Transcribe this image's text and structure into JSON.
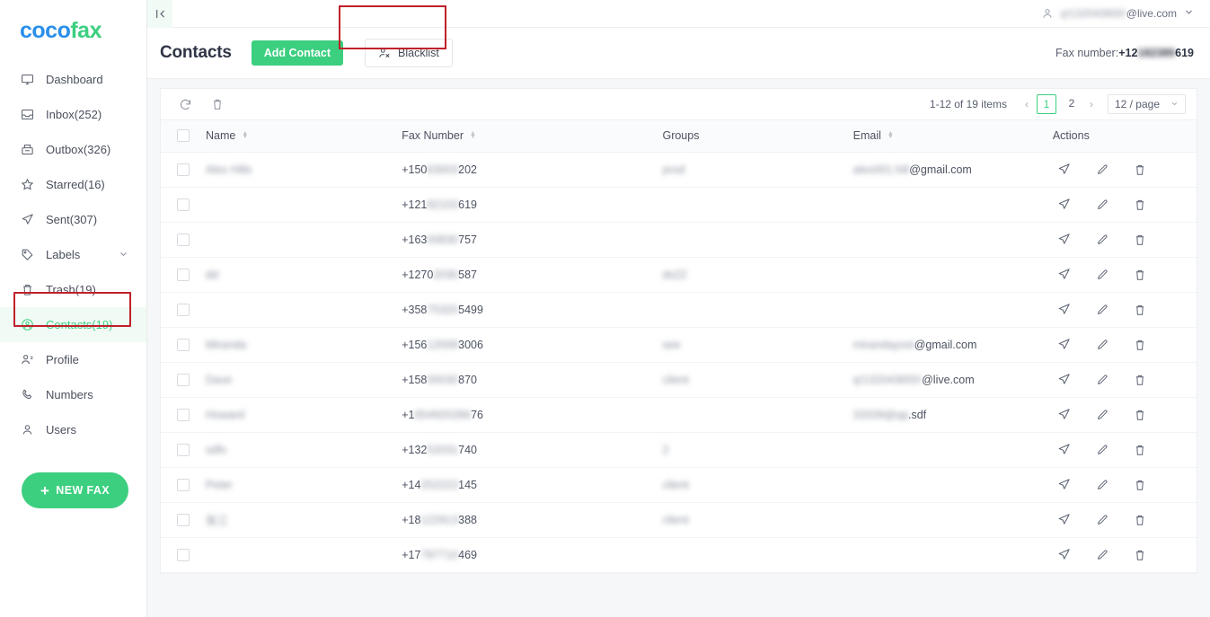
{
  "brand": {
    "name_part1": "coco",
    "name_part2": "fax"
  },
  "sidebar": {
    "items": [
      {
        "label": "Dashboard",
        "icon": "monitor-icon",
        "active": false
      },
      {
        "label": "Inbox(252)",
        "icon": "inbox-icon",
        "active": false
      },
      {
        "label": "Outbox(326)",
        "icon": "outbox-icon",
        "active": false
      },
      {
        "label": "Starred(16)",
        "icon": "star-icon",
        "active": false
      },
      {
        "label": "Sent(307)",
        "icon": "send-icon",
        "active": false
      },
      {
        "label": "Labels",
        "icon": "tag-icon",
        "active": false
      },
      {
        "label": "Trash(19)",
        "icon": "trash-icon",
        "active": false
      },
      {
        "label": "Contacts(19)",
        "icon": "contact-icon",
        "active": true
      },
      {
        "label": "Profile",
        "icon": "profile-icon",
        "active": false
      },
      {
        "label": "Numbers",
        "icon": "phone-icon",
        "active": false
      },
      {
        "label": "Users",
        "icon": "user-icon",
        "active": false
      }
    ],
    "new_fax_label": "NEW FAX",
    "new_fax_plus": "+"
  },
  "topbar": {
    "collapse_icon": "collapse-left-icon",
    "account_email_blurred": "q!132043655!",
    "account_email_domain": "@live.com",
    "caret": "▼"
  },
  "header": {
    "title": "Contacts",
    "add_contact_label": "Add Contact",
    "blacklist_label": "Blacklist",
    "fax_number_label": "Fax number:",
    "fax_number_prefix": "+12",
    "fax_number_blurred": "182389",
    "fax_number_suffix": "619"
  },
  "toolbar": {
    "refresh_icon": "refresh-icon",
    "delete_icon": "trash-icon"
  },
  "pagination": {
    "summary": "1-12 of 19 items",
    "prev": "‹",
    "next": "›",
    "pages": [
      "1",
      "2"
    ],
    "active_page": "1",
    "page_size": "12 / page",
    "caret": "⌄"
  },
  "table": {
    "columns": [
      {
        "key": "check",
        "label": "",
        "sortable": false
      },
      {
        "key": "name",
        "label": "Name",
        "sortable": true
      },
      {
        "key": "fax",
        "label": "Fax Number",
        "sortable": true
      },
      {
        "key": "groups",
        "label": "Groups",
        "sortable": false
      },
      {
        "key": "email",
        "label": "Email",
        "sortable": true
      },
      {
        "key": "actions",
        "label": "Actions",
        "sortable": false
      }
    ],
    "action_icons": [
      "send-icon",
      "edit-icon",
      "delete-icon"
    ],
    "rows": [
      {
        "name_blurred": "Alex Hills",
        "fax_prefix": "+150",
        "fax_blurred": "63003",
        "fax_suffix": "202",
        "group_blurred": "prod",
        "email_blurred": "alex001.hill",
        "email_domain": "@gmail.com"
      },
      {
        "name_blurred": "",
        "fax_prefix": "+121",
        "fax_blurred": "82103",
        "fax_suffix": "619",
        "group_blurred": "",
        "email_blurred": "",
        "email_domain": ""
      },
      {
        "name_blurred": "",
        "fax_prefix": "+163",
        "fax_blurred": "00830",
        "fax_suffix": "757",
        "group_blurred": "",
        "email_blurred": "",
        "email_domain": ""
      },
      {
        "name_blurred": "dd",
        "fax_prefix": "+1270",
        "fax_blurred": "2030",
        "fax_suffix": "587",
        "group_blurred": "ds22",
        "email_blurred": "",
        "email_domain": ""
      },
      {
        "name_blurred": "",
        "fax_prefix": "+358",
        "fax_blurred": "75320",
        "fax_suffix": "5499",
        "group_blurred": "",
        "email_blurred": "",
        "email_domain": ""
      },
      {
        "name_blurred": "Miranda",
        "fax_prefix": "+156",
        "fax_blurred": "12008",
        "fax_suffix": "3006",
        "group_blurred": "see",
        "email_blurred": "mirandayost",
        "email_domain": "@gmail.com"
      },
      {
        "name_blurred": "Dave",
        "fax_prefix": "+158",
        "fax_blurred": "00030",
        "fax_suffix": "870",
        "group_blurred": "client",
        "email_blurred": "q!132043655!",
        "email_domain": "@live.com"
      },
      {
        "name_blurred": "Howard",
        "fax_prefix": "+1",
        "fax_blurred": "654920286",
        "fax_suffix": "76",
        "group_blurred": "",
        "email_blurred": "33339@qq",
        "email_domain": ".sdf"
      },
      {
        "name_blurred": "sdfs",
        "fax_prefix": "+132",
        "fax_blurred": "52031",
        "fax_suffix": "740",
        "group_blurred": "2",
        "email_blurred": "",
        "email_domain": ""
      },
      {
        "name_blurred": "Peter",
        "fax_prefix": "+14",
        "fax_blurred": "252222",
        "fax_suffix": "145",
        "group_blurred": "client",
        "email_blurred": "",
        "email_domain": ""
      },
      {
        "name_blurred": "张三",
        "fax_prefix": "+18",
        "fax_blurred": "122913",
        "fax_suffix": "388",
        "group_blurred": "client",
        "email_blurred": "",
        "email_domain": ""
      },
      {
        "name_blurred": "",
        "fax_prefix": "+17",
        "fax_blurred": "787710",
        "fax_suffix": "469",
        "group_blurred": "",
        "email_blurred": "",
        "email_domain": ""
      }
    ]
  },
  "annotations": {
    "blacklist_highlight_color": "#c0202a",
    "contacts_highlight_color": "#c0202a"
  },
  "colors": {
    "brand_green": "#3ccf80",
    "brand_blue": "#2a8fea",
    "annotation_red": "#c0202a"
  }
}
